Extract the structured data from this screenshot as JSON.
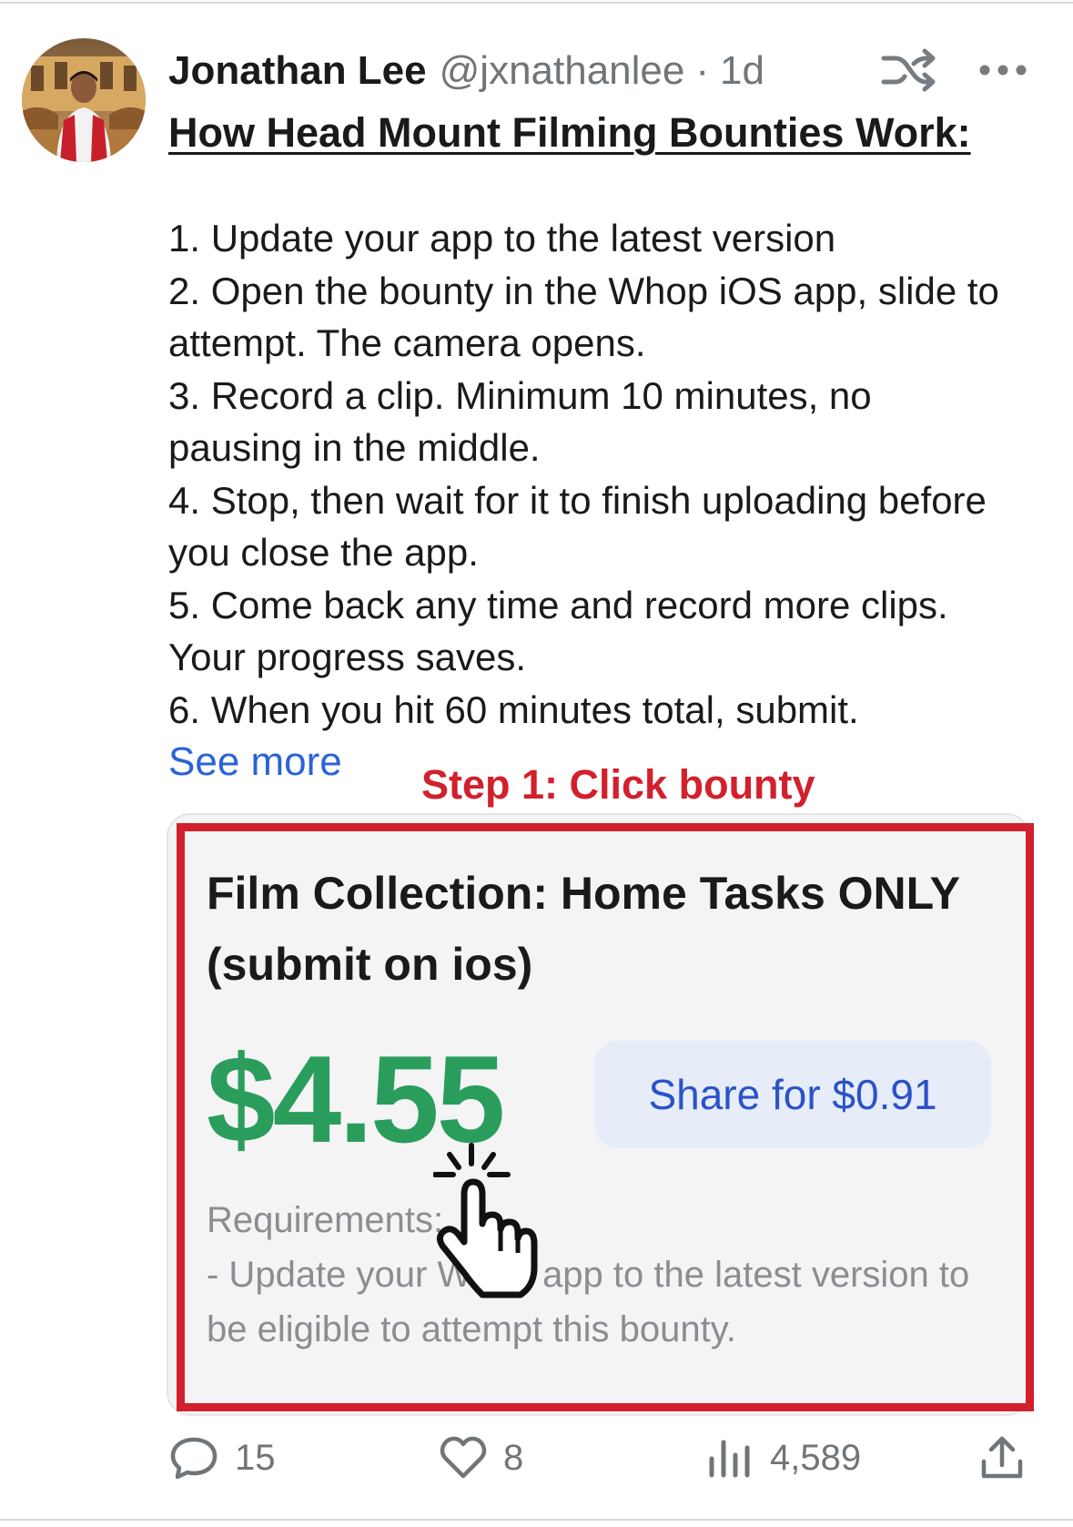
{
  "post": {
    "author_name": "Jonathan Lee",
    "handle": "@jxnathanlee",
    "separator": "·",
    "time": "1d",
    "heading": "How Head Mount Filming Bounties Work:",
    "steps": [
      "1. Update your app to the latest version",
      "2. Open the bounty in the Whop iOS app, slide to attempt. The camera opens.",
      "3. Record a clip. Minimum 10 minutes, no pausing in the middle.",
      "4. Stop, then wait for it to finish uploading before you close the app.",
      "5. Come back any time and record more clips. Your progress saves.",
      "6. When you hit 60 minutes total, submit."
    ],
    "see_more": "See more"
  },
  "annotation": {
    "text": "Step 1: Click bounty",
    "color": "#d2202c"
  },
  "bounty_card": {
    "title_line1": "Film Collection: Home Tasks ONLY",
    "title_line2": "(submit on ios)",
    "price": "$4.55",
    "share_label": "Share for $0.91",
    "requirements_label": "Requirements:",
    "requirements_text": "- Update your Whop app to the latest version to be eligible to attempt this bounty."
  },
  "actions": {
    "replies": "15",
    "likes": "8",
    "views": "4,589"
  },
  "icons": {
    "header": [
      "shuffle-icon",
      "more-icon"
    ],
    "actions": [
      "reply-icon",
      "heart-icon",
      "views-icon",
      "share-icon"
    ],
    "overlay": [
      "hand-pointer-icon"
    ]
  },
  "colors": {
    "price_green": "#2a9d5c",
    "link_blue": "#2a63d6",
    "share_button_bg": "#e6ecf8",
    "share_button_text": "#2a52c9",
    "highlight_red": "#d2202c",
    "muted_gray": "#6f7579"
  }
}
